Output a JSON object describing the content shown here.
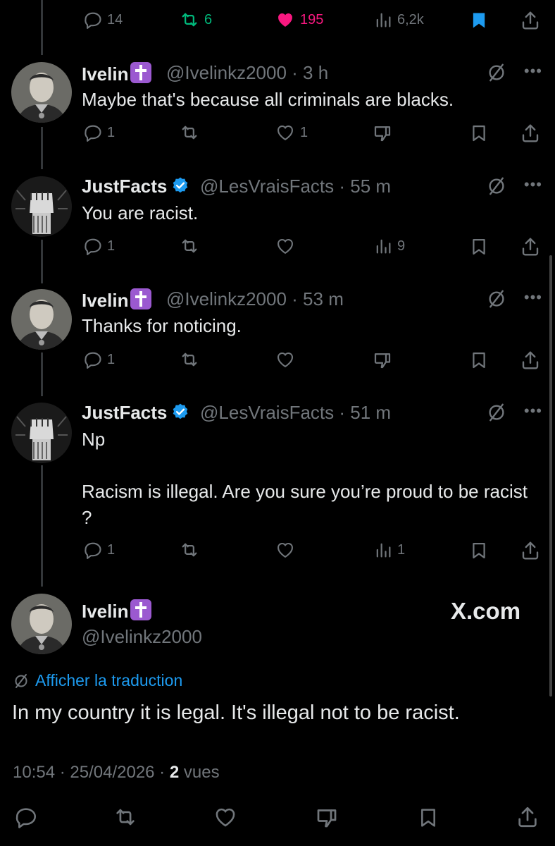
{
  "top_actions": {
    "replies": "14",
    "reposts": "6",
    "likes": "195",
    "views": "6,2k"
  },
  "colors": {
    "repost_green": "#00ba7c",
    "like_pink": "#f91880",
    "bookmark_blue": "#1d9bf0",
    "link_blue": "#1d9bf0",
    "cross_purple": "#9b59d0"
  },
  "tweets": [
    {
      "name": "Ivelin",
      "handle": "@Ivelinkz2000",
      "time": "3 h",
      "text": "Maybe that's because all criminals are blacks.",
      "replies": "1",
      "likes": "1",
      "avatar": "officer-portrait",
      "badge": "latin-cross-icon"
    },
    {
      "name": "JustFacts",
      "handle": "@LesVraisFacts",
      "time": "55 m",
      "text": "You are racist.",
      "replies": "1",
      "views": "9",
      "avatar": "raised-fist",
      "badge": "verified-icon"
    },
    {
      "name": "Ivelin",
      "handle": "@Ivelinkz2000",
      "time": "53 m",
      "text": "Thanks for noticing.",
      "replies": "1",
      "avatar": "officer-portrait",
      "badge": "latin-cross-icon"
    },
    {
      "name": "JustFacts",
      "handle": "@LesVraisFacts",
      "time": "51 m",
      "text": "Np\n\nRacism is illegal. Are you sure you’re proud to be racist ?",
      "replies": "1",
      "views": "1",
      "avatar": "raised-fist",
      "badge": "verified-icon"
    }
  ],
  "main": {
    "name": "Ivelin",
    "handle": "@Ivelinkz2000",
    "watermark": "X.com",
    "translate": "Afficher la traduction",
    "text": "In my country it is legal. It's illegal not to be racist.",
    "time": "10:54",
    "date": "25/04/2026",
    "views_count": "2",
    "views_label": "vues"
  }
}
